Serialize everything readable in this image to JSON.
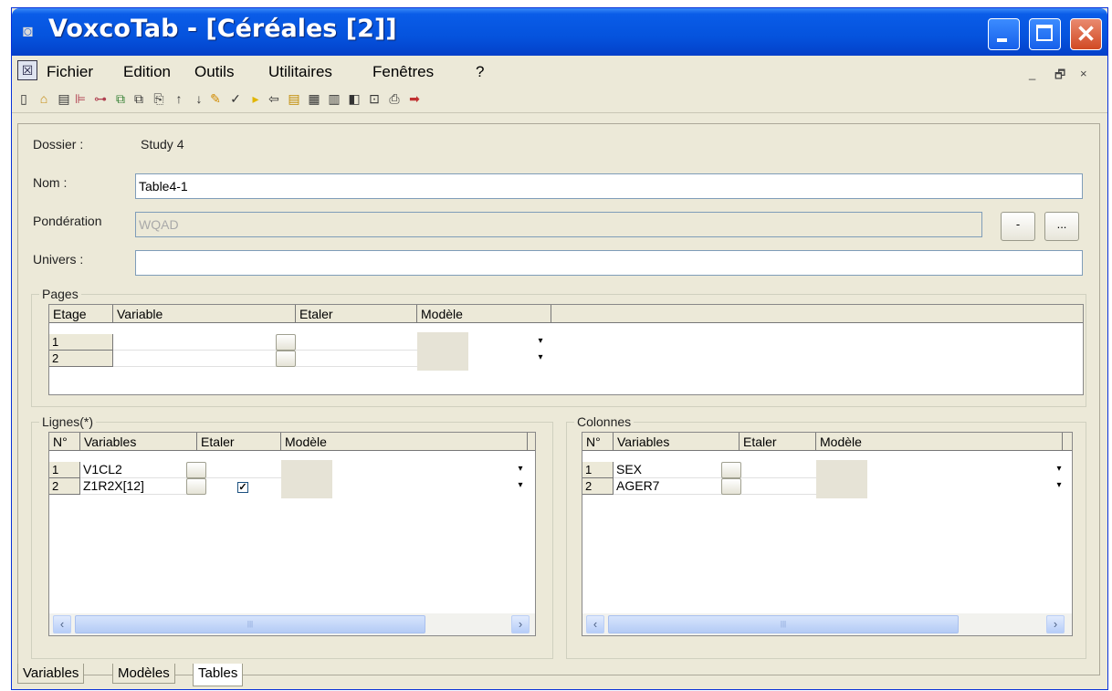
{
  "window": {
    "title": "VoxcoTab - [Céréales [2]]",
    "close_glyph": "✕"
  },
  "menu": [
    "Fichier",
    "Edition",
    "Outils",
    "Utilitaires",
    "Fenêtres",
    "?"
  ],
  "mdi_controls": {
    "minimize": "_",
    "restore": "🗗",
    "close": "×"
  },
  "toolbar_icons": [
    "new-icon",
    "open-icon",
    "save-icon",
    "insert-row-icon",
    "insert-col-icon",
    "copy-add-icon",
    "copy-icon",
    "paste-icon",
    "arrow-up-icon",
    "arrow-down-icon",
    "wand-icon",
    "check-icon",
    "run-icon",
    "back-icon",
    "doc-icon",
    "table-icon",
    "list-icon",
    "grid-icon",
    "preview-icon",
    "print-icon",
    "export-icon"
  ],
  "form": {
    "dossier_label": "Dossier :",
    "dossier_value": "Study 4",
    "nom_label": "Nom :",
    "nom_value": "Table4-1",
    "ponderation_label": "Pondération",
    "ponderation_value": "WQAD",
    "ponderation_btn1": "-",
    "ponderation_btn2": "...",
    "univers_label": "Univers :",
    "univers_value": ""
  },
  "pages": {
    "legend": "Pages",
    "headers": [
      "Etage",
      "Variable",
      "Etaler",
      "Modèle"
    ],
    "rows": [
      {
        "num": "1",
        "variable": ""
      },
      {
        "num": "2",
        "variable": ""
      }
    ]
  },
  "lignes": {
    "legend": "Lignes(*)",
    "headers": [
      "N°",
      "Variables",
      "Etaler",
      "Modèle"
    ],
    "rows": [
      {
        "num": "1",
        "variable": "V1CL2",
        "etaler": false
      },
      {
        "num": "2",
        "variable": "Z1R2X[12]",
        "etaler": true
      }
    ]
  },
  "colonnes": {
    "legend": "Colonnes",
    "headers": [
      "N°",
      "Variables",
      "Etaler",
      "Modèle"
    ],
    "rows": [
      {
        "num": "1",
        "variable": "SEX"
      },
      {
        "num": "2",
        "variable": "AGER7"
      }
    ]
  },
  "tabs": [
    "Variables",
    "Modèles",
    "Tables"
  ],
  "active_tab": "Tables"
}
